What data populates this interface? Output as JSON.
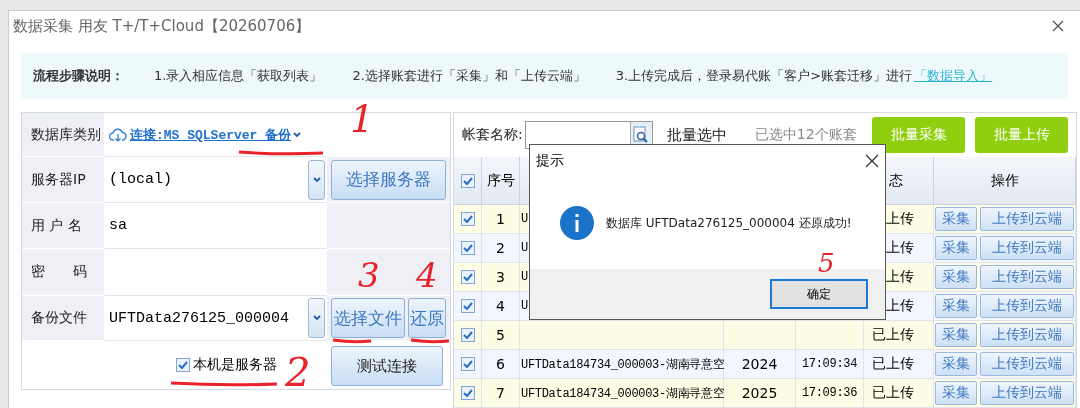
{
  "window": {
    "title": "数据采集 用友 T+/T+Cloud【20260706】"
  },
  "steps": {
    "label": "流程步骤说明：",
    "items": [
      "1.录入相应信息「获取列表」",
      "2.选择账套进行「采集」和「上传云端」",
      "3.上传完成后，登录易代账「客户>账套迁移」进行"
    ],
    "link": "「数据导入」"
  },
  "form": {
    "db_type": {
      "label": "数据库类别",
      "value": "连接:MS SQLServer 备份"
    },
    "rows": [
      {
        "kind": "select",
        "label": "服务器IP",
        "value": "(local)",
        "buttons": [
          "选择服务器"
        ]
      },
      {
        "kind": "text",
        "label": "用 户 名",
        "value": "sa"
      },
      {
        "kind": "text",
        "label": "密　　码"
      },
      {
        "kind": "select",
        "label": "备份文件",
        "value": "UFTData276125_000004",
        "buttons": [
          "选择文件",
          "还原"
        ]
      }
    ],
    "local_server": {
      "label": "本机是服务器",
      "checked": true
    },
    "test_button": "测试连接"
  },
  "toolbar": {
    "search_label": "帐套名称:",
    "batch_select": "批量选中",
    "selected_count": "已选中12个账套",
    "buttons": [
      "批量采集",
      "批量上传"
    ]
  },
  "table": {
    "header_checked": true,
    "columns": {
      "index": "序号",
      "status": "态",
      "actions": "操作"
    },
    "rows": [
      {
        "checked": true,
        "index": "1",
        "name": "U",
        "status": "上传",
        "actions": [
          "采集",
          "上传到云端"
        ]
      },
      {
        "checked": true,
        "index": "2",
        "name": "U",
        "status": "上传",
        "actions": [
          "采集",
          "上传到云端"
        ]
      },
      {
        "checked": true,
        "index": "3",
        "name": "U",
        "status": "上传",
        "actions": [
          "采集",
          "上传到云端"
        ]
      },
      {
        "checked": true,
        "index": "4",
        "name": "U",
        "status": "上传",
        "actions": [
          "采集",
          "上传到云端"
        ]
      },
      {
        "checked": true,
        "index": "5",
        "status": "已上传",
        "actions": [
          "采集",
          "上传到云端"
        ]
      },
      {
        "checked": true,
        "index": "6",
        "name": "UFTData184734_000003-湖南寻意空",
        "year": "2024",
        "time": "17:09:34",
        "status": "已上传",
        "actions": [
          "采集",
          "上传到云端"
        ]
      },
      {
        "checked": true,
        "index": "7",
        "name": "UFTData184734_000003-湖南寻意空",
        "year": "2025",
        "time": "17:09:36",
        "status": "已上传",
        "actions": [
          "采集",
          "上传到云端"
        ]
      }
    ]
  },
  "dialog": {
    "title": "提示",
    "message": "数据库 UFTData276125_000004 还原成功!",
    "ok": "确定"
  },
  "annotations": [
    "1",
    "2",
    "3",
    "4",
    "5"
  ]
}
